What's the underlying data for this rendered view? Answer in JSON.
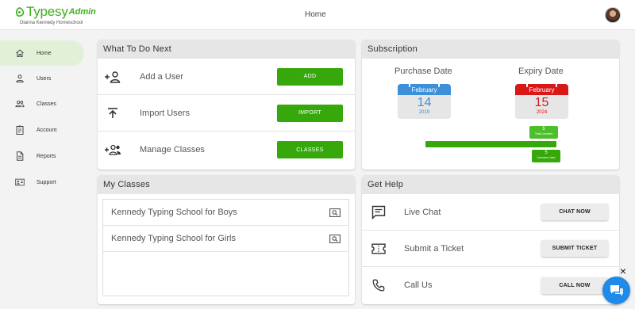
{
  "brand": {
    "name": "Typesy",
    "suffix": "Admin",
    "subtitle": "Dianna Kennedy Homeschool",
    "color": "#3fae1e"
  },
  "header": {
    "title": "Home"
  },
  "sidebar": {
    "items": [
      {
        "label": "Home",
        "icon": "home-icon",
        "active": true
      },
      {
        "label": "Users",
        "icon": "user-icon"
      },
      {
        "label": "Classes",
        "icon": "group-icon"
      },
      {
        "label": "Account",
        "icon": "clipboard-icon"
      },
      {
        "label": "Reports",
        "icon": "document-icon"
      },
      {
        "label": "Support",
        "icon": "contact-card-icon"
      }
    ]
  },
  "what_to_do": {
    "title": "What To Do Next",
    "rows": [
      {
        "label": "Add a User",
        "button": "ADD",
        "icon": "add-user-icon"
      },
      {
        "label": "Import Users",
        "button": "IMPORT",
        "icon": "upload-icon"
      },
      {
        "label": "Manage Classes",
        "button": "CLASSES",
        "icon": "add-group-icon"
      }
    ]
  },
  "subscription": {
    "title": "Subscription",
    "purchase": {
      "label": "Purchase Date",
      "month": "February",
      "day": "14",
      "year": "2019",
      "color": "#3d8fd8"
    },
    "expiry": {
      "label": "Expiry Date",
      "month": "February",
      "day": "15",
      "year": "2024",
      "color": "#d81818"
    },
    "licenses": {
      "total": {
        "value": "5",
        "caption": "Total Licenses"
      },
      "used": {
        "value": "5",
        "caption": "Licenses Used"
      }
    }
  },
  "my_classes": {
    "title": "My Classes",
    "items": [
      {
        "name": "Kennedy Typing School for Boys"
      },
      {
        "name": "Kennedy Typing School for Girls"
      }
    ]
  },
  "get_help": {
    "title": "Get Help",
    "rows": [
      {
        "label": "Live Chat",
        "button": "CHAT NOW",
        "icon": "chat-icon"
      },
      {
        "label": "Submit a Ticket",
        "button": "SUBMIT TICKET",
        "icon": "ticket-icon"
      },
      {
        "label": "Call Us",
        "button": "CALL NOW",
        "icon": "phone-icon"
      }
    ]
  },
  "widget": {
    "close": "×",
    "chat_color": "#1f8ae8"
  },
  "colors": {
    "accent_green": "#36a80b",
    "active_nav_bg": "#e3f0d8"
  }
}
